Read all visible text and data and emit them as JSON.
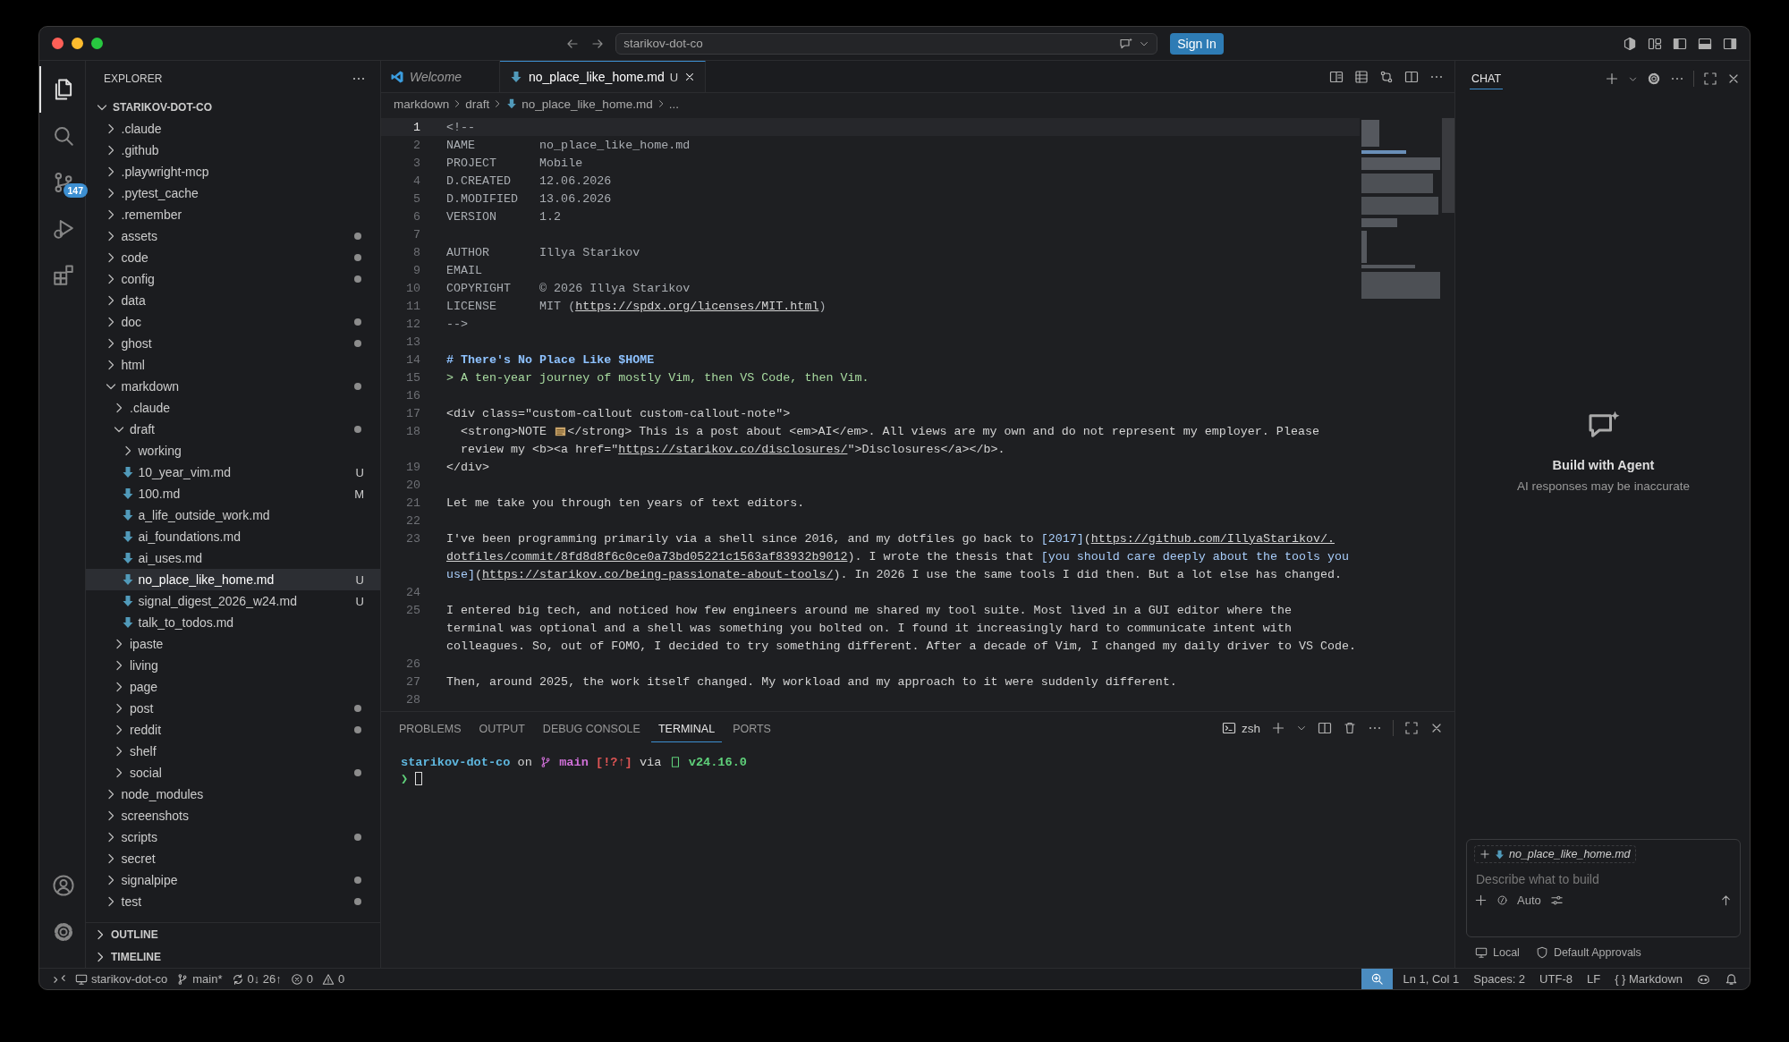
{
  "title_bar": {
    "search": "starikov-dot-co",
    "sign_in": "Sign In"
  },
  "activity_bar": {
    "items": [
      {
        "kind": "files",
        "selected": true
      },
      {
        "kind": "search",
        "selected": false
      },
      {
        "kind": "source-control",
        "selected": false,
        "badge": "147"
      },
      {
        "kind": "run",
        "selected": false
      },
      {
        "kind": "extensions",
        "selected": false
      }
    ]
  },
  "sidebar": {
    "title": "EXPLORER",
    "tree": [
      {
        "label": "STARIKOV-DOT-CO",
        "kind": "root",
        "expanded": true,
        "selected": false,
        "dirty": false,
        "children": [
          {
            "label": ".claude",
            "kind": "folder",
            "expanded": false,
            "selected": false,
            "dirty": false
          },
          {
            "label": ".github",
            "kind": "folder",
            "expanded": false,
            "selected": false,
            "dirty": false
          },
          {
            "label": ".playwright-mcp",
            "kind": "folder",
            "expanded": false,
            "selected": false,
            "dirty": false
          },
          {
            "label": ".pytest_cache",
            "kind": "folder",
            "expanded": false,
            "selected": false,
            "dirty": false
          },
          {
            "label": ".remember",
            "kind": "folder",
            "expanded": false,
            "selected": false,
            "dirty": false
          },
          {
            "label": "assets",
            "kind": "folder",
            "expanded": false,
            "selected": false,
            "dirty": true
          },
          {
            "label": "code",
            "kind": "folder",
            "expanded": false,
            "selected": false,
            "dirty": true
          },
          {
            "label": "config",
            "kind": "folder",
            "expanded": false,
            "selected": false,
            "dirty": true
          },
          {
            "label": "data",
            "kind": "folder",
            "expanded": false,
            "selected": false,
            "dirty": false
          },
          {
            "label": "doc",
            "kind": "folder",
            "expanded": false,
            "selected": false,
            "dirty": true
          },
          {
            "label": "ghost",
            "kind": "folder",
            "expanded": false,
            "selected": false,
            "dirty": true
          },
          {
            "label": "html",
            "kind": "folder",
            "expanded": false,
            "selected": false,
            "dirty": false
          },
          {
            "label": "markdown",
            "kind": "folder",
            "expanded": true,
            "selected": false,
            "dirty": true,
            "children": [
              {
                "label": ".claude",
                "kind": "folder",
                "expanded": false,
                "selected": false,
                "dirty": false
              },
              {
                "label": "draft",
                "kind": "folder",
                "expanded": true,
                "selected": false,
                "dirty": true,
                "children": [
                  {
                    "label": "working",
                    "kind": "folder",
                    "expanded": false,
                    "selected": false,
                    "dirty": false
                  },
                  {
                    "label": "10_year_vim.md",
                    "kind": "file",
                    "selected": false,
                    "dirty": false,
                    "badge": "U"
                  },
                  {
                    "label": "100.md",
                    "kind": "file",
                    "selected": false,
                    "dirty": false,
                    "badge": "M"
                  },
                  {
                    "label": "a_life_outside_work.md",
                    "kind": "file",
                    "selected": false,
                    "dirty": false
                  },
                  {
                    "label": "ai_foundations.md",
                    "kind": "file",
                    "selected": false,
                    "dirty": false
                  },
                  {
                    "label": "ai_uses.md",
                    "kind": "file",
                    "selected": false,
                    "dirty": false
                  },
                  {
                    "label": "no_place_like_home.md",
                    "kind": "file",
                    "selected": true,
                    "dirty": false,
                    "badge": "U"
                  },
                  {
                    "label": "signal_digest_2026_w24.md",
                    "kind": "file",
                    "selected": false,
                    "dirty": false,
                    "badge": "U"
                  },
                  {
                    "label": "talk_to_todos.md",
                    "kind": "file",
                    "selected": false,
                    "dirty": false
                  }
                ]
              },
              {
                "label": "ipaste",
                "kind": "folder",
                "expanded": false,
                "selected": false,
                "dirty": false
              },
              {
                "label": "living",
                "kind": "folder",
                "expanded": false,
                "selected": false,
                "dirty": false
              },
              {
                "label": "page",
                "kind": "folder",
                "expanded": false,
                "selected": false,
                "dirty": false
              },
              {
                "label": "post",
                "kind": "folder",
                "expanded": false,
                "selected": false,
                "dirty": true
              },
              {
                "label": "reddit",
                "kind": "folder",
                "expanded": false,
                "selected": false,
                "dirty": true
              },
              {
                "label": "shelf",
                "kind": "folder",
                "expanded": false,
                "selected": false,
                "dirty": false
              },
              {
                "label": "social",
                "kind": "folder",
                "expanded": false,
                "selected": false,
                "dirty": true
              }
            ]
          },
          {
            "label": "node_modules",
            "kind": "folder",
            "expanded": false,
            "selected": false,
            "dirty": false
          },
          {
            "label": "screenshots",
            "kind": "folder",
            "expanded": false,
            "selected": false,
            "dirty": false
          },
          {
            "label": "scripts",
            "kind": "folder",
            "expanded": false,
            "selected": false,
            "dirty": true
          },
          {
            "label": "secret",
            "kind": "folder",
            "expanded": false,
            "selected": false,
            "dirty": false
          },
          {
            "label": "signalpipe",
            "kind": "folder",
            "expanded": false,
            "selected": false,
            "dirty": true
          },
          {
            "label": "test",
            "kind": "folder",
            "expanded": false,
            "selected": false,
            "dirty": true
          }
        ]
      }
    ],
    "sections": [
      {
        "label": "OUTLINE",
        "expanded": false
      },
      {
        "label": "TIMELINE",
        "expanded": false
      }
    ]
  },
  "editor": {
    "tabs": [
      {
        "label": "Welcome",
        "kind": "welcome",
        "selected": false
      },
      {
        "label": "no_place_like_home.md",
        "kind": "markdown",
        "selected": true,
        "badge": "U"
      }
    ],
    "breadcrumbs": [
      {
        "label": "markdown",
        "kind": "folder"
      },
      {
        "label": "draft",
        "kind": "folder"
      },
      {
        "label": "no_place_like_home.md",
        "kind": "markdown"
      },
      {
        "label": "...",
        "kind": "more"
      }
    ],
    "lines": [
      {
        "number": "1",
        "active": true,
        "rows": [
          {
            "segments": [
              {
                "kind": "comment",
                "text": "<!--"
              }
            ]
          }
        ]
      },
      {
        "number": "2",
        "active": false,
        "rows": [
          {
            "segments": [
              {
                "kind": "comment",
                "text": "NAME         no_place_like_home.md"
              }
            ]
          }
        ]
      },
      {
        "number": "3",
        "active": false,
        "rows": [
          {
            "segments": [
              {
                "kind": "comment",
                "text": "PROJECT      Mobile"
              }
            ]
          }
        ]
      },
      {
        "number": "4",
        "active": false,
        "rows": [
          {
            "segments": [
              {
                "kind": "comment",
                "text": "D.CREATED    12.06.2026"
              }
            ]
          }
        ]
      },
      {
        "number": "5",
        "active": false,
        "rows": [
          {
            "segments": [
              {
                "kind": "comment",
                "text": "D.MODIFIED   13.06.2026"
              }
            ]
          }
        ]
      },
      {
        "number": "6",
        "active": false,
        "rows": [
          {
            "segments": [
              {
                "kind": "comment",
                "text": "VERSION      1.2"
              }
            ]
          }
        ]
      },
      {
        "number": "7",
        "active": false
      },
      {
        "number": "8",
        "active": false,
        "rows": [
          {
            "segments": [
              {
                "kind": "comment",
                "text": "AUTHOR       Illya Starikov"
              }
            ]
          }
        ]
      },
      {
        "number": "9",
        "active": false,
        "rows": [
          {
            "segments": [
              {
                "kind": "comment",
                "text": "EMAIL"
              }
            ]
          }
        ]
      },
      {
        "number": "10",
        "active": false,
        "rows": [
          {
            "segments": [
              {
                "kind": "comment",
                "text": "COPYRIGHT    © 2026 Illya Starikov"
              }
            ]
          }
        ]
      },
      {
        "number": "11",
        "active": false,
        "rows": [
          {
            "segments": [
              {
                "kind": "comment",
                "text": "LICENSE      MIT ("
              },
              {
                "kind": "url",
                "text": "https://spdx.org/licenses/MIT.html"
              },
              {
                "kind": "comment",
                "text": ")"
              }
            ]
          }
        ]
      },
      {
        "number": "12",
        "active": false,
        "rows": [
          {
            "segments": [
              {
                "kind": "comment",
                "text": "-->"
              }
            ]
          }
        ]
      },
      {
        "number": "13",
        "active": false
      },
      {
        "number": "14",
        "active": false,
        "rows": [
          {
            "segments": [
              {
                "kind": "heading",
                "text": "# There's No Place Like $HOME"
              }
            ]
          }
        ]
      },
      {
        "number": "15",
        "active": false,
        "rows": [
          {
            "segments": [
              {
                "kind": "quote",
                "text": "> A ten-year journey of mostly Vim, then VS Code, then Vim."
              }
            ]
          }
        ]
      },
      {
        "number": "16",
        "active": false
      },
      {
        "number": "17",
        "active": false,
        "rows": [
          {
            "segments": [
              {
                "kind": "plain",
                "text": "<div class=\"custom-callout custom-callout-note\">"
              }
            ]
          }
        ]
      },
      {
        "number": "18",
        "active": false,
        "rows": [
          {
            "segments": [
              {
                "kind": "plain",
                "text": "  <strong>NOTE "
              },
              {
                "kind": "scroll"
              },
              {
                "kind": "plain",
                "text": "</strong> This is a post about <em>AI</em>. All views are my own and do not represent my employer. Please"
              }
            ]
          },
          {
            "segments": [
              {
                "kind": "plain",
                "text": "  review my <b><a href=\""
              },
              {
                "kind": "url",
                "text": "https://starikov.co/disclosures/"
              },
              {
                "kind": "plain",
                "text": "\">Disclosures</a></b>."
              }
            ]
          }
        ]
      },
      {
        "number": "19",
        "active": false,
        "rows": [
          {
            "segments": [
              {
                "kind": "plain",
                "text": "</div>"
              }
            ]
          }
        ]
      },
      {
        "number": "20",
        "active": false
      },
      {
        "number": "21",
        "active": false,
        "rows": [
          {
            "segments": [
              {
                "kind": "plain",
                "text": "Let me take you through ten years of text editors."
              }
            ]
          }
        ]
      },
      {
        "number": "22",
        "active": false
      },
      {
        "number": "23",
        "active": false,
        "rows": [
          {
            "segments": [
              {
                "kind": "plain",
                "text": "I've been programming primarily via a shell since 2016, and my dotfiles go back to "
              },
              {
                "kind": "linktext",
                "text": "[2017]"
              },
              {
                "kind": "plain",
                "text": "("
              },
              {
                "kind": "url",
                "text": "https://github.com/IllyaStarikov/."
              }
            ]
          },
          {
            "segments": [
              {
                "kind": "url",
                "text": "dotfiles/commit/8fd8d8f6c0ce0a73bd05221c1563af83932b9012"
              },
              {
                "kind": "plain",
                "text": "). I wrote the thesis that "
              },
              {
                "kind": "linktext",
                "text": "[you should care deeply about the tools you"
              }
            ]
          },
          {
            "segments": [
              {
                "kind": "linktext",
                "text": "use]"
              },
              {
                "kind": "plain",
                "text": "("
              },
              {
                "kind": "url",
                "text": "https://starikov.co/being-passionate-about-tools/"
              },
              {
                "kind": "plain",
                "text": "). In 2026 I use the same tools I did then. But a lot else has changed."
              }
            ]
          }
        ]
      },
      {
        "number": "24",
        "active": false
      },
      {
        "number": "25",
        "active": false,
        "rows": [
          {
            "segments": [
              {
                "kind": "plain",
                "text": "I entered big tech, and noticed how few engineers around me shared my tool suite. Most lived in a GUI editor where the"
              }
            ]
          },
          {
            "segments": [
              {
                "kind": "plain",
                "text": "terminal was optional and a shell was something you bolted on. I found it increasingly hard to communicate intent with"
              }
            ]
          },
          {
            "segments": [
              {
                "kind": "plain",
                "text": "colleagues. So, out of FOMO, I decided to try something different. After a decade of Vim, I changed my daily driver to VS Code."
              }
            ]
          }
        ]
      },
      {
        "number": "26",
        "active": false
      },
      {
        "number": "27",
        "active": false,
        "rows": [
          {
            "segments": [
              {
                "kind": "plain",
                "text": "Then, around 2025, the work itself changed. My workload and my approach to it were suddenly different."
              }
            ]
          }
        ]
      },
      {
        "number": "28",
        "active": false
      }
    ]
  },
  "panel": {
    "tabs": [
      {
        "label": "PROBLEMS",
        "selected": false
      },
      {
        "label": "OUTPUT",
        "selected": false
      },
      {
        "label": "DEBUG CONSOLE",
        "selected": false
      },
      {
        "label": "TERMINAL",
        "selected": true
      },
      {
        "label": "PORTS",
        "selected": false
      }
    ],
    "shell": "zsh",
    "terminal": [
      {
        "segments": [
          {
            "kind": "dir",
            "text": "starikov-dot-co"
          },
          {
            "kind": "plain",
            "text": " on "
          },
          {
            "kind": "branch"
          },
          {
            "kind": "branchname",
            "text": " main"
          },
          {
            "kind": "status",
            "text": " [!?↑]"
          },
          {
            "kind": "plain",
            "text": " via "
          },
          {
            "kind": "glyph"
          },
          {
            "kind": "version",
            "text": " v24.16.0"
          }
        ]
      },
      {
        "segments": [
          {
            "kind": "prompt",
            "text": "❯ "
          },
          {
            "kind": "cursor"
          }
        ]
      }
    ]
  },
  "chat": {
    "title": "CHAT",
    "heading": "Build with Agent",
    "subtitle": "AI responses may be inaccurate",
    "attachment": "no_place_like_home.md",
    "placeholder": "Describe what to build",
    "mode": "Auto",
    "footer": [
      {
        "kind": "local",
        "label": "Local"
      },
      {
        "kind": "approvals",
        "label": "Default Approvals"
      }
    ]
  },
  "status_bar": {
    "left": [
      {
        "kind": "remote"
      },
      {
        "kind": "repo",
        "text": "starikov-dot-co"
      },
      {
        "kind": "branch",
        "text": "main*"
      },
      {
        "kind": "sync",
        "text": "0↓ 26↑"
      },
      {
        "kind": "errors",
        "text": "0"
      },
      {
        "kind": "warnings",
        "text": "0"
      }
    ],
    "right": [
      {
        "kind": "zoom"
      },
      {
        "kind": "text",
        "text": "Ln 1, Col 1"
      },
      {
        "kind": "text",
        "text": "Spaces: 2"
      },
      {
        "kind": "text",
        "text": "UTF-8"
      },
      {
        "kind": "text",
        "text": "LF"
      },
      {
        "kind": "text",
        "text": "{ } Markdown"
      },
      {
        "kind": "assistant"
      },
      {
        "kind": "bell"
      }
    ]
  }
}
